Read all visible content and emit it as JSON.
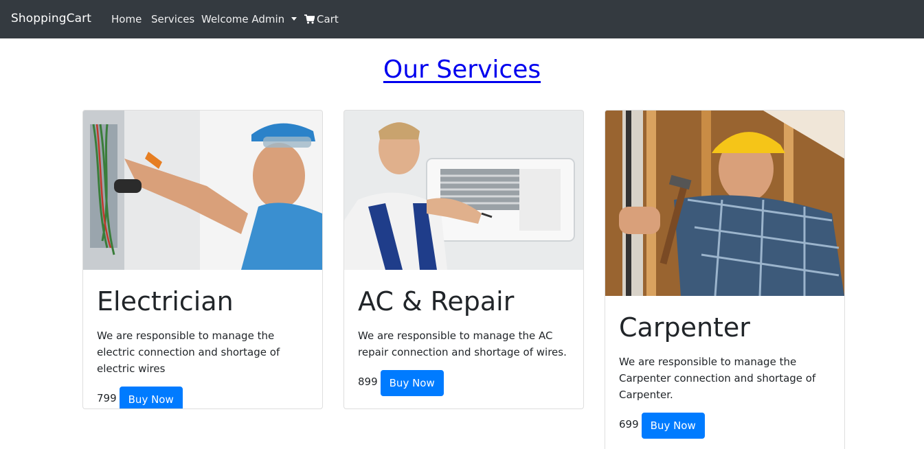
{
  "navbar": {
    "brand": "ShoppingCart",
    "links": [
      "Home",
      "Services",
      "Welcome Admin",
      "Cart"
    ]
  },
  "page": {
    "title": "Our Services"
  },
  "cards": [
    {
      "title": "Electrician",
      "text": "We are responsible to manage the electric connection and shortage of electric wires",
      "price": "799",
      "button": "Buy Now"
    },
    {
      "title": "AC & Repair",
      "text": "We are responsible to manage the AC repair connection and shortage of wires.",
      "price": "899",
      "button": "Buy Now"
    },
    {
      "title": "Carpenter",
      "text": "We are responsible to manage the Carpenter connection and shortage of Carpenter.",
      "price": "699",
      "button": "Buy Now"
    }
  ],
  "colors": {
    "navbar_bg": "#343a40",
    "link_blue": "#0000ee",
    "button_blue": "#007bff"
  }
}
